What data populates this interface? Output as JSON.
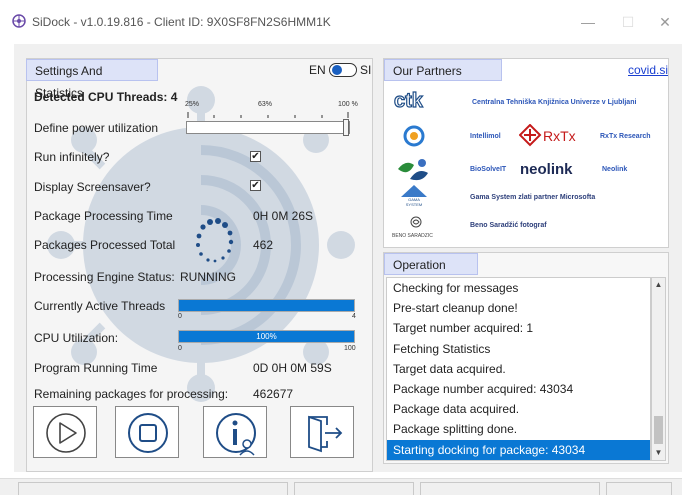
{
  "window": {
    "title": "SiDock - v1.0.19.816 - Client ID: 9X0SF8FN2S6HMM1K",
    "minimize_label": "—",
    "maximize_label": "☐",
    "close_label": "✕"
  },
  "settings": {
    "tab_label": "Settings And Statistics",
    "lang_en": "EN",
    "lang_si": "SI",
    "cpu_threads_label": "Detected CPU Threads: 4",
    "power_ticks": [
      "25%",
      "63%",
      "100 %"
    ],
    "power_label": "Define power utilization",
    "power_level_fraction": 1.0,
    "run_infinitely_label": "Run infinitely?",
    "run_infinitely_checked": true,
    "screensaver_label": "Display Screensaver?",
    "screensaver_checked": true,
    "processing_time_label": "Package Processing Time",
    "processing_time_value": "0H 0M 26S",
    "processed_total_label": "Packages Processed Total",
    "processed_total_value": "462",
    "engine_status_label": "Processing Engine Status:",
    "engine_status_value": "RUNNING",
    "active_threads_label": "Currently Active Threads",
    "active_threads_min": "0",
    "active_threads_max": "4",
    "active_threads_value": 4,
    "cpu_util_label": "CPU Utilization:",
    "cpu_util_min": "0",
    "cpu_util_max": "100",
    "cpu_util_text": "100%",
    "cpu_util_value": 100,
    "running_time_label": "Program Running Time",
    "running_time_value": "0D 0H 0M 59S",
    "remaining_label": "Remaining packages for processing:",
    "remaining_value": "462677"
  },
  "controls": {
    "play_icon": "play-icon",
    "stop_icon": "stop-icon",
    "info_icon": "info-user-icon",
    "exit_icon": "exit-door-icon"
  },
  "partners": {
    "tab_label": "Our Partners",
    "link_text": "covid.si",
    "ctk_text": "Centralna Tehniška Knjižnica Univerze v Ljubljani",
    "intellimol": "Intellimol",
    "rxtx_logo": "RxTx",
    "rxtx_text": "RxTx Research",
    "biosolveit": "BioSolveIT",
    "neolink_logo": "neolink",
    "neolink_text": "Neolink",
    "gama_logo": "GAMA SYSTEM",
    "gama_text": "Gama System zlati partner Microsofta",
    "beno_logo": "BENO SARADZIC",
    "beno_text": "Beno Saradžić fotograf"
  },
  "log": {
    "tab_label": "Operation Log",
    "entries": [
      "Checking for messages",
      "Pre-start cleanup done!",
      "Target number acquired: 1",
      "Fetching Statistics",
      "Target data acquired.",
      "Package number acquired: 43034",
      "Package data acquired.",
      "Package splitting done.",
      "Starting docking for package: 43034"
    ],
    "selected_index": 8
  },
  "colors": {
    "accent": "#0a78d4",
    "tab_bg": "#dde3f8",
    "link": "#1a3fd0"
  }
}
